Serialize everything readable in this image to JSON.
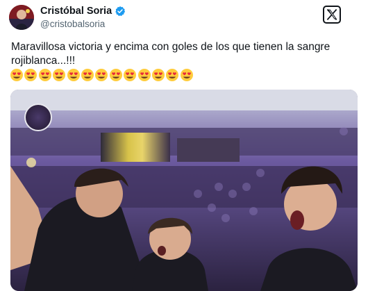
{
  "author": {
    "display_name": "Cristóbal Soria",
    "handle": "@cristobalsoria",
    "verified": true,
    "avatar_icon": "avatar-photo"
  },
  "platform_icon": "x-logo-icon",
  "tweet": {
    "text": "Maravillosa victoria y encima con goles de los que tienen la sangre rojiblanca...!!!",
    "emoji_count": 13,
    "emoji_icon": "heart-eyes-emoji"
  },
  "media": {
    "description_icon": "photo",
    "badge_icon": "club-crest-watermark"
  },
  "colors": {
    "verified_blue": "#1d9bf0",
    "text": "#0f1419",
    "muted": "#536471",
    "jersey": "#1b1a22",
    "stand_purple": "#5b3f8a"
  }
}
